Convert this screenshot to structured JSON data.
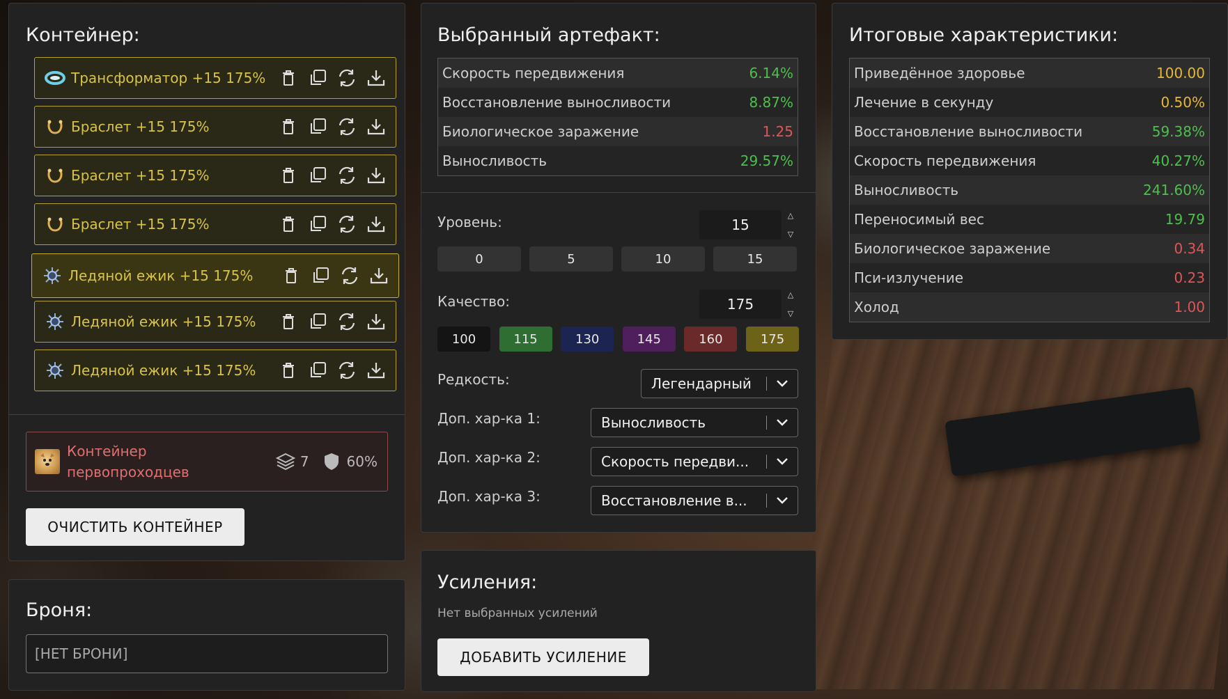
{
  "container": {
    "title": "Контейнер:",
    "items": [
      {
        "name": "Трансформатор +15 175%",
        "icon": "transformer-icon"
      },
      {
        "name": "Браслет +15 175%",
        "icon": "bracelet-icon"
      },
      {
        "name": "Браслет +15 175%",
        "icon": "bracelet-icon"
      },
      {
        "name": "Браслет +15 175%",
        "icon": "bracelet-icon"
      },
      {
        "name": "Ледяной ежик +15 175%",
        "icon": "ice-hedgehog-icon"
      },
      {
        "name": "Ледяной ежик +15 175%",
        "icon": "ice-hedgehog-icon"
      },
      {
        "name": "Ледяной ежик +15 175%",
        "icon": "ice-hedgehog-icon"
      }
    ],
    "selected_index": 4,
    "card": {
      "name": "Контейнер первопроходцев",
      "slots": "7",
      "protection": "60%"
    },
    "clear_button": "ОЧИСТИТЬ КОНТЕЙНЕР"
  },
  "armor": {
    "title": "Броня:",
    "value": "[НЕТ БРОНИ]"
  },
  "artifact": {
    "title": "Выбранный артефакт:",
    "stats": [
      {
        "label": "Скорость передвижения",
        "value": "6.14%",
        "color": "green"
      },
      {
        "label": "Восстановление выносливости",
        "value": "8.87%",
        "color": "green"
      },
      {
        "label": "Биологическое заражение",
        "value": "1.25",
        "color": "red"
      },
      {
        "label": "Выносливость",
        "value": "29.57%",
        "color": "green"
      }
    ],
    "level_label": "Уровень:",
    "level_value": "15",
    "level_presets": [
      "0",
      "5",
      "10",
      "15"
    ],
    "quality_label": "Качество:",
    "quality_value": "175",
    "quality_presets": [
      {
        "label": "100",
        "color": "#141414"
      },
      {
        "label": "115",
        "color": "#2f6e33"
      },
      {
        "label": "130",
        "color": "#1c2452"
      },
      {
        "label": "145",
        "color": "#4e1f5a"
      },
      {
        "label": "160",
        "color": "#6b2a2a"
      },
      {
        "label": "175",
        "color": "#6e6218"
      }
    ],
    "rarity_label": "Редкость:",
    "rarity_value": "Легендарный",
    "extra1_label": "Доп. хар-ка 1:",
    "extra1_value": "Выносливость",
    "extra2_label": "Доп. хар-ка 2:",
    "extra2_value": "Скорость передви...",
    "extra3_label": "Доп. хар-ка 3:",
    "extra3_value": "Восстановление в..."
  },
  "boosts": {
    "title": "Усиления:",
    "empty": "Нет выбранных усилений",
    "add_button": "ДОБАВИТЬ УСИЛЕНИЕ"
  },
  "totals": {
    "title": "Итоговые характеристики:",
    "stats": [
      {
        "label": "Приведённое здоровье",
        "value": "100.00",
        "color": "yellow"
      },
      {
        "label": "Лечение в секунду",
        "value": "0.50%",
        "color": "yellow"
      },
      {
        "label": "Восстановление выносливости",
        "value": "59.38%",
        "color": "green"
      },
      {
        "label": "Скорость передвижения",
        "value": "40.27%",
        "color": "green"
      },
      {
        "label": "Выносливость",
        "value": "241.60%",
        "color": "green"
      },
      {
        "label": "Переносимый вес",
        "value": "19.79",
        "color": "green"
      },
      {
        "label": "Биологическое заражение",
        "value": "0.34",
        "color": "red"
      },
      {
        "label": "Пси-излучение",
        "value": "0.23",
        "color": "red"
      },
      {
        "label": "Холод",
        "value": "1.00",
        "color": "red"
      }
    ]
  }
}
